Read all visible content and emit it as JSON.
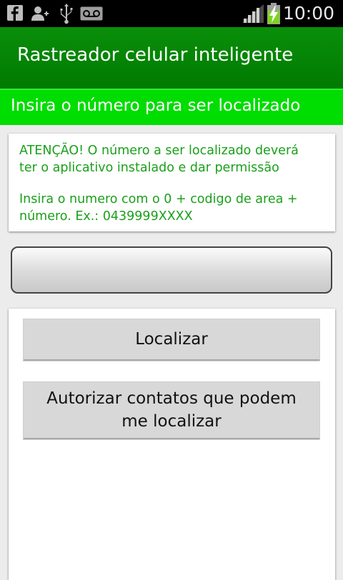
{
  "status_bar": {
    "time": "10:00",
    "icons": [
      "facebook-icon",
      "add-contact-icon",
      "usb-icon",
      "voicemail-icon",
      "signal-icon",
      "battery-charging-icon"
    ]
  },
  "app": {
    "title": "Rastreador celular inteligente"
  },
  "subtitle": "Insira o número para ser localizado",
  "info": {
    "line1": "ATENÇÃO! O número a ser localizado deverá",
    "line2": "ter o aplicativo instalado e dar permissão",
    "line3": "Insira o numero com o 0 + codigo de area +",
    "line4": "número. Ex.: 0439999XXXX"
  },
  "phone_input": {
    "value": "",
    "placeholder": ""
  },
  "buttons": {
    "localizar": "Localizar",
    "autorizar_line1": "Autorizar contatos que podem",
    "autorizar_line2": "me localizar"
  },
  "colors": {
    "title_bar": "#007f00",
    "subtitle_bar": "#00dd00",
    "info_text": "#1aa01a",
    "button_bg": "#d8d8d8"
  }
}
